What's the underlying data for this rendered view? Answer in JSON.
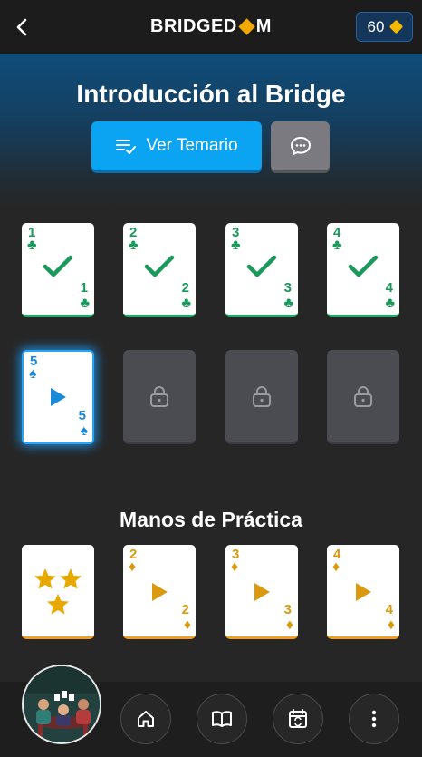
{
  "header": {
    "logo_text_left": "BRIDGED",
    "logo_text_right": "M",
    "coins": "60"
  },
  "lesson": {
    "title": "Introducción al Bridge",
    "temario_label": "Ver Temario"
  },
  "lesson_cards": [
    {
      "rank": "1",
      "suit": "♣",
      "status": "completed"
    },
    {
      "rank": "2",
      "suit": "♣",
      "status": "completed"
    },
    {
      "rank": "3",
      "suit": "♣",
      "status": "completed"
    },
    {
      "rank": "4",
      "suit": "♣",
      "status": "completed"
    },
    {
      "rank": "5",
      "suit": "♠",
      "status": "current"
    },
    {
      "status": "locked"
    },
    {
      "status": "locked"
    },
    {
      "status": "locked"
    }
  ],
  "practice": {
    "title": "Manos de Práctica",
    "cards": [
      {
        "type": "stars",
        "icon": "star-icon"
      },
      {
        "rank": "2",
        "suit": "♦",
        "status": "play"
      },
      {
        "rank": "3",
        "suit": "♦",
        "status": "play"
      },
      {
        "rank": "4",
        "suit": "♦",
        "status": "play"
      }
    ]
  },
  "nav": {
    "items": [
      "home-icon",
      "book-icon",
      "calendar-icon",
      "more-icon"
    ]
  },
  "colors": {
    "accent": "#0aa4f2",
    "completed": "#1a9a5a",
    "current": "#1a8ad8",
    "practice": "#d99a10"
  }
}
